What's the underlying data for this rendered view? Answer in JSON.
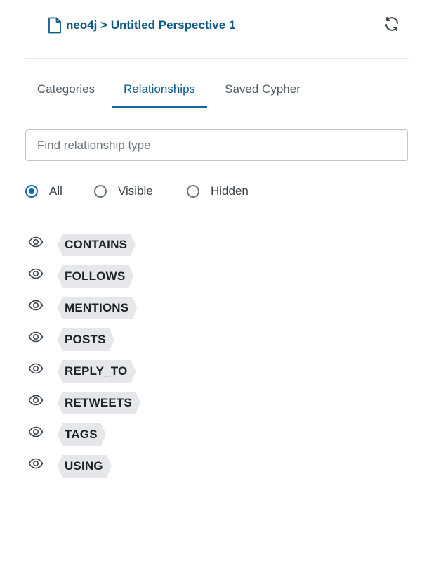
{
  "header": {
    "breadcrumb_text": "neo4j > Untitled Perspective 1",
    "breadcrumb_icon": "file-icon",
    "refresh_icon": "refresh-icon"
  },
  "tabs": [
    {
      "label": "Categories",
      "active": false
    },
    {
      "label": "Relationships",
      "active": true
    },
    {
      "label": "Saved Cypher",
      "active": false
    }
  ],
  "search": {
    "placeholder": "Find relationship type",
    "value": ""
  },
  "filter": {
    "options": [
      "All",
      "Visible",
      "Hidden"
    ],
    "selected": "All"
  },
  "relationships": [
    {
      "label": "CONTAINS",
      "icon": "eye-icon"
    },
    {
      "label": "FOLLOWS",
      "icon": "eye-icon"
    },
    {
      "label": "MENTIONS",
      "icon": "eye-icon"
    },
    {
      "label": "POSTS",
      "icon": "eye-icon"
    },
    {
      "label": "REPLY_TO",
      "icon": "eye-icon"
    },
    {
      "label": "RETWEETS",
      "icon": "eye-icon"
    },
    {
      "label": "TAGS",
      "icon": "eye-icon"
    },
    {
      "label": "USING",
      "icon": "eye-icon"
    }
  ],
  "colors": {
    "accent": "#0b6aa6",
    "breadcrumb": "#0b5a8a",
    "tag_background": "#e5e7ea"
  }
}
